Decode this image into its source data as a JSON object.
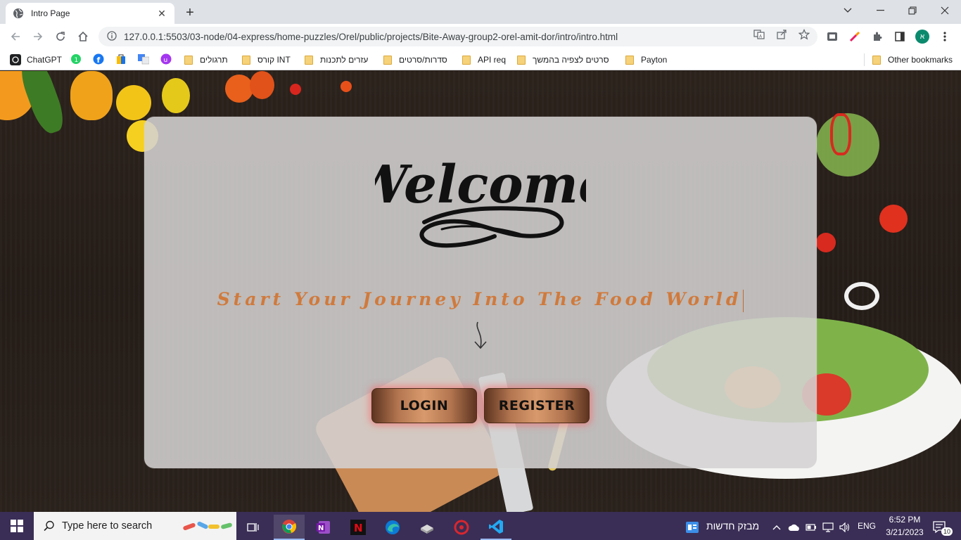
{
  "browser": {
    "tab_title": "Intro Page",
    "url": "127.0.0.1:5503/03-node/04-express/home-puzzles/Orel/public/projects/Bite-Away-group2-orel-amit-dor/intro/intro.html",
    "profile_initial": "א"
  },
  "bookmarks": {
    "chatgpt": "ChatGPT",
    "exercises": "תרגולים",
    "int_course": "קורס INT",
    "code_helpers": "עזרים לתכנות",
    "series_movies": "סדרות/סרטים",
    "api_req": "API req",
    "movies_watch": "סרטים לצפיה בהמשך",
    "payton": "Payton",
    "other": "Other bookmarks"
  },
  "page": {
    "welcome_script": "Welcome",
    "tagline": "Start Your Journey Into The Food World",
    "login_label": "LOGIN",
    "register_label": "REGISTER"
  },
  "taskbar": {
    "search_placeholder": "Type here to search",
    "news_label": "מבזק חדשות",
    "language": "ENG",
    "time": "6:52 PM",
    "date": "3/21/2023",
    "notification_count": "10"
  },
  "colors": {
    "tagline": "#d07a3c",
    "taskbar": "#3a2e56",
    "button_glow": "#ff5a5a"
  }
}
